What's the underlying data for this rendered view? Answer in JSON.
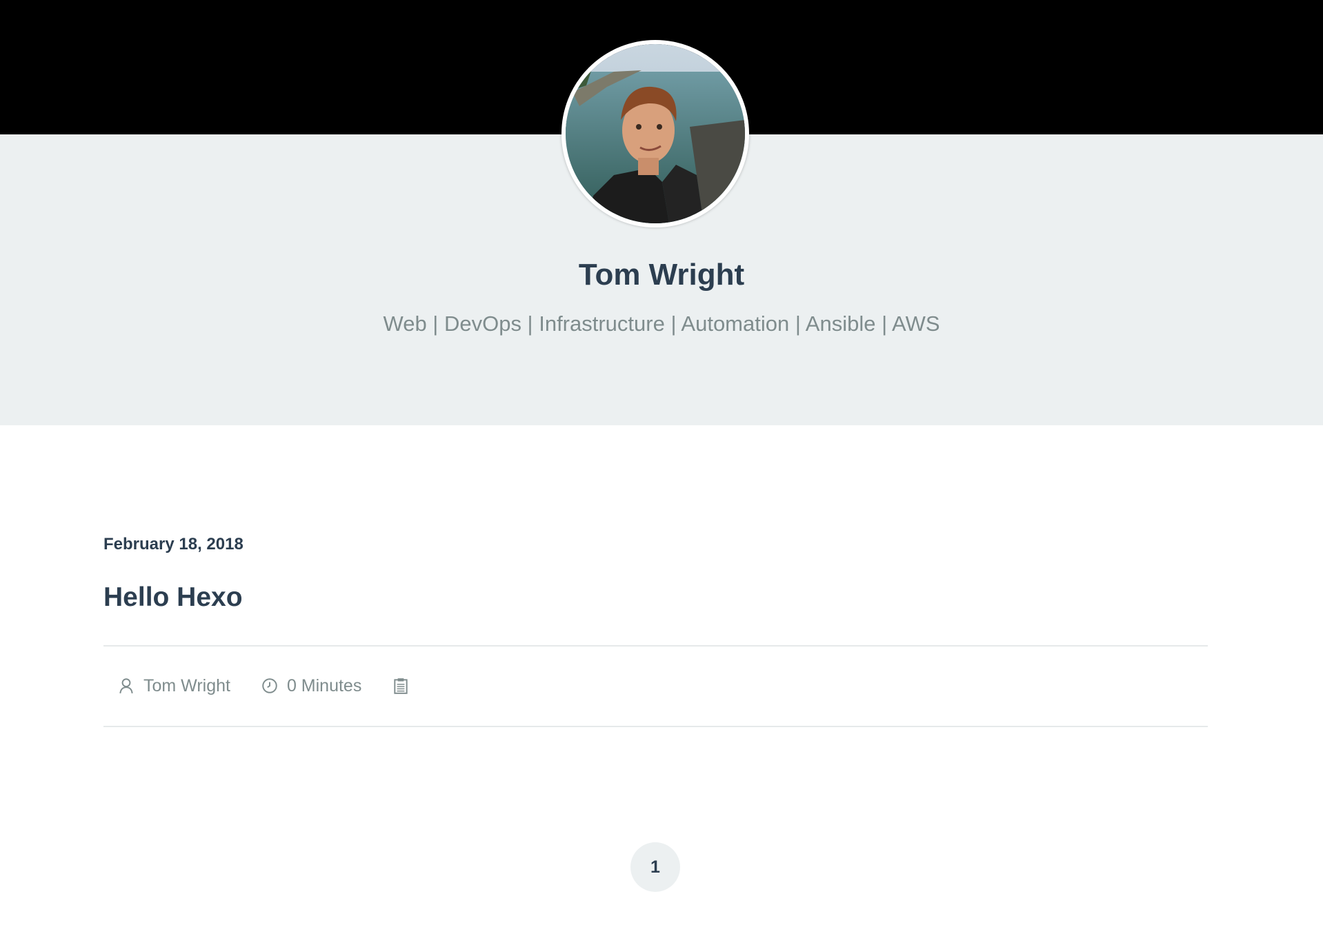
{
  "header": {
    "site_name": "Tom Wright",
    "tagline": "Web | DevOps | Infrastructure | Automation | Ansible | AWS",
    "avatar_icon": "profile-photo"
  },
  "post": {
    "date": "February 18, 2018",
    "title": "Hello Hexo",
    "meta": {
      "author": "Tom Wright",
      "author_icon": "user-icon",
      "reading_time": "0 Minutes",
      "reading_time_icon": "clock-icon",
      "category_icon": "clipboard-icon"
    }
  },
  "pagination": {
    "current_page": "1"
  },
  "colors": {
    "header_bg": "#000000",
    "hero_bg": "#ecf0f1",
    "heading": "#2c3e50",
    "muted": "#7f8c8d"
  }
}
